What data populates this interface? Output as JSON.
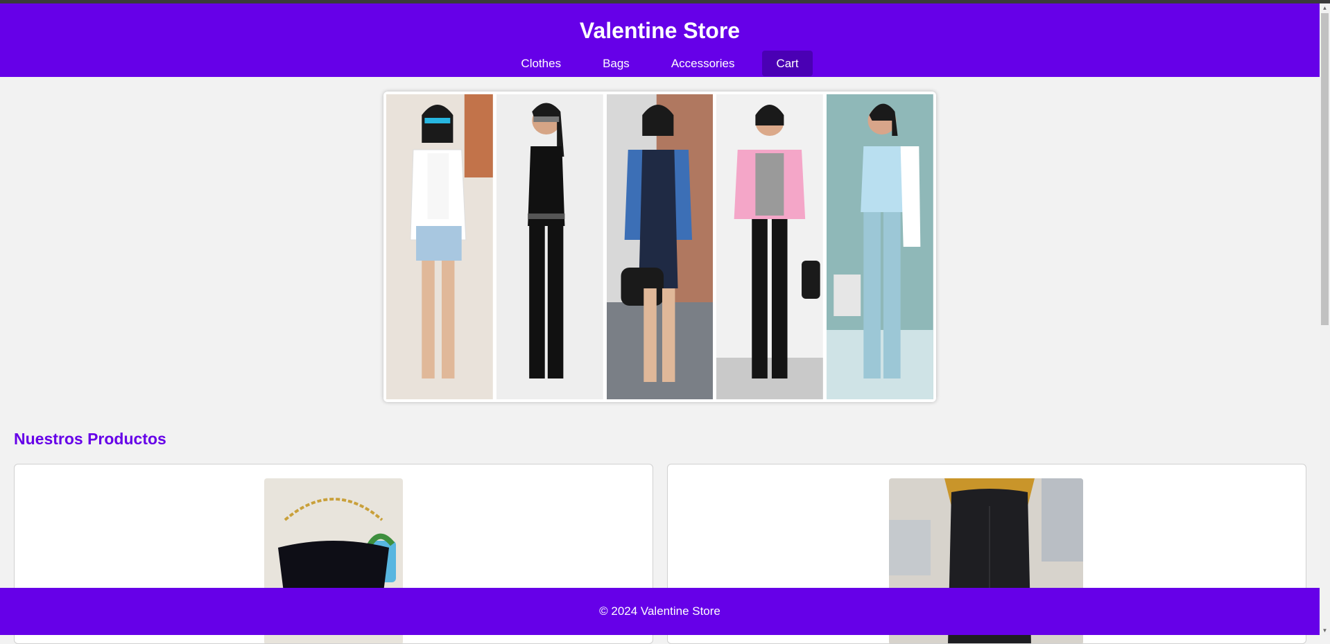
{
  "header": {
    "title": "Valentine Store",
    "nav": [
      {
        "label": "Clothes"
      },
      {
        "label": "Bags"
      },
      {
        "label": "Accessories"
      },
      {
        "label": "Cart"
      }
    ]
  },
  "hero": {
    "looks": [
      {
        "top": "white blazer, denim shorts",
        "color": "#ffffff"
      },
      {
        "top": "black halter jumpsuit",
        "color": "#111111"
      },
      {
        "top": "denim jacket, navy dress",
        "color": "#2c3e66"
      },
      {
        "top": "pink jacket, black jeans",
        "color": "#f4a6c8"
      },
      {
        "top": "light blue top and pants",
        "color": "#9cc7d6"
      }
    ]
  },
  "products": {
    "title": "Nuestros Productos"
  },
  "footer": {
    "text": "© 2024 Valentine Store"
  }
}
